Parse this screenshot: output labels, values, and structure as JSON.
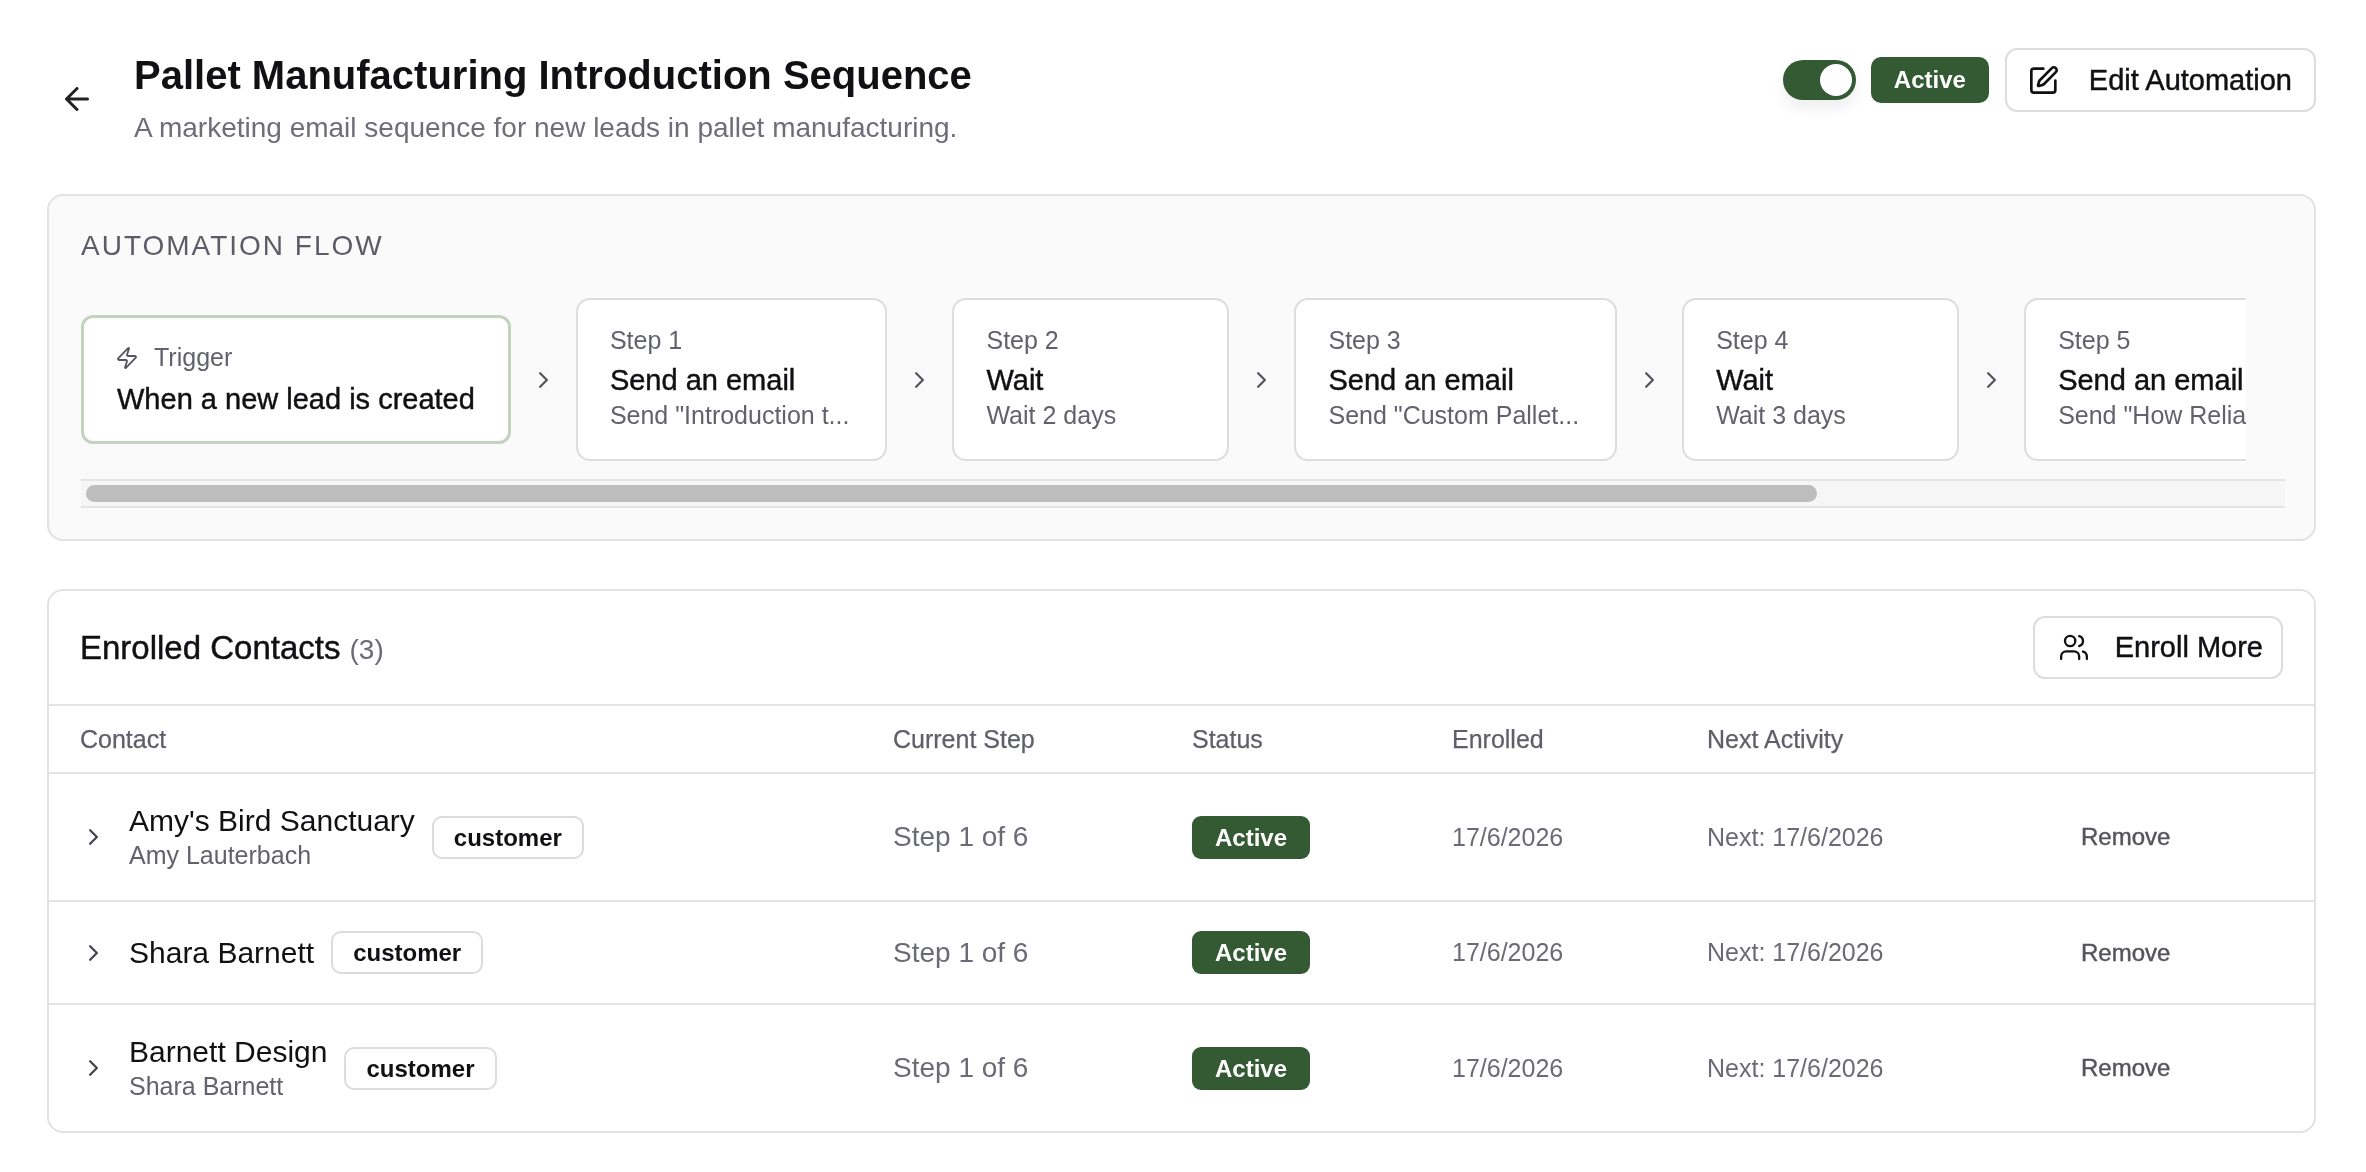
{
  "header": {
    "title": "Pallet Manufacturing Introduction Sequence",
    "subtitle": "A marketing email sequence for new leads in pallet manufacturing."
  },
  "automation": {
    "on": true,
    "status": "Active",
    "edit_button": "Edit Automation"
  },
  "flow": {
    "heading": "AUTOMATION FLOW",
    "nodes": [
      {
        "kind": "trigger",
        "label": "Trigger",
        "title": "When a new lead is created"
      },
      {
        "kind": "step",
        "label": "Step 1",
        "title": "Send an email",
        "detail": "Send \"Introduction t..."
      },
      {
        "kind": "step",
        "label": "Step 2",
        "title": "Wait",
        "detail": "Wait 2 days"
      },
      {
        "kind": "step",
        "label": "Step 3",
        "title": "Send an email",
        "detail": "Send \"Custom Pallet..."
      },
      {
        "kind": "step",
        "label": "Step 4",
        "title": "Wait",
        "detail": "Wait 3 days"
      },
      {
        "kind": "step",
        "label": "Step 5",
        "title": "Send an email",
        "detail": "Send \"How Relia"
      }
    ]
  },
  "contacts": {
    "title": "Enrolled Contacts",
    "count": "(3)",
    "enroll_button": "Enroll More",
    "columns": [
      "Contact",
      "Current Step",
      "Status",
      "Enrolled",
      "Next Activity"
    ],
    "rows": [
      {
        "expanded": false,
        "name": "Amy's Bird Sanctuary",
        "person": "Amy Lauterbach",
        "tag": "customer",
        "current_step": "Step 1 of 6",
        "status": "Active",
        "enrolled": "17/6/2026",
        "next_activity": "Next: 17/6/2026",
        "action": "Remove"
      },
      {
        "expanded": false,
        "name": "Shara Barnett",
        "tag": "customer",
        "current_step": "Step 1 of 6",
        "status": "Active",
        "enrolled": "17/6/2026",
        "next_activity": "Next: 17/6/2026",
        "action": "Remove"
      },
      {
        "expanded": false,
        "name": "Barnett Design",
        "person": "Shara Barnett",
        "tag": "customer",
        "current_step": "Step 1 of 6",
        "status": "Active",
        "enrolled": "17/6/2026",
        "next_activity": "Next: 17/6/2026",
        "action": "Remove"
      }
    ]
  }
}
